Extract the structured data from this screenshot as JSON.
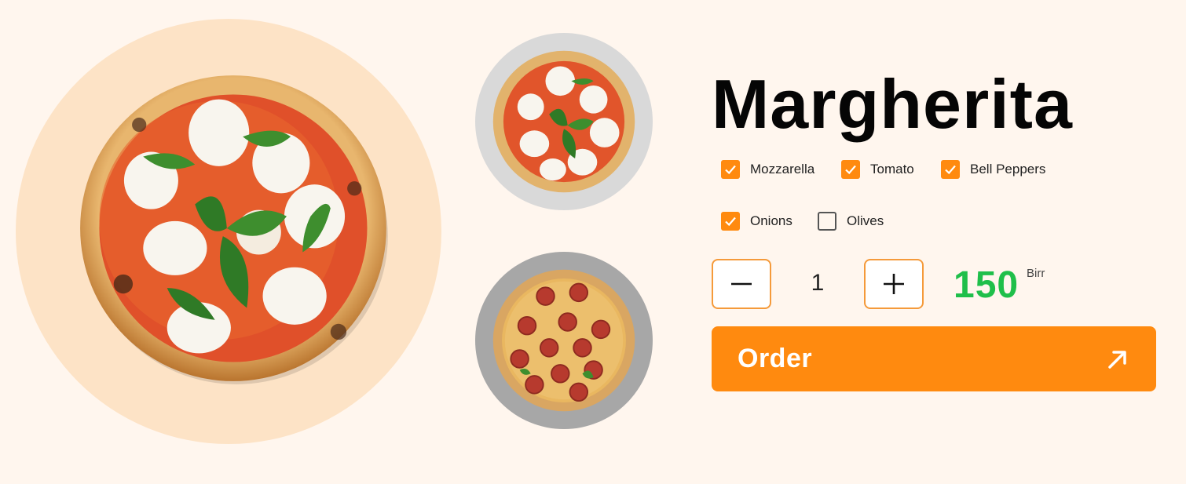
{
  "product": {
    "name": "Margherita",
    "price": "150",
    "currency": "Birr",
    "quantity": "1"
  },
  "toppings": [
    {
      "label": "Mozzarella",
      "checked": true
    },
    {
      "label": "Tomato",
      "checked": true
    },
    {
      "label": "Bell Peppers",
      "checked": true
    },
    {
      "label": "Onions",
      "checked": true
    },
    {
      "label": "Olives",
      "checked": false
    }
  ],
  "thumbnails": [
    {
      "name": "margherita-thumbnail"
    },
    {
      "name": "pepperoni-thumbnail"
    }
  ],
  "order": {
    "label": "Order",
    "icon": "arrow-up-right-icon"
  },
  "colors": {
    "accent": "#ff8a0f",
    "price": "#1fbf4a",
    "background": "#fff6ee",
    "hero_circle": "#fde3c6"
  }
}
